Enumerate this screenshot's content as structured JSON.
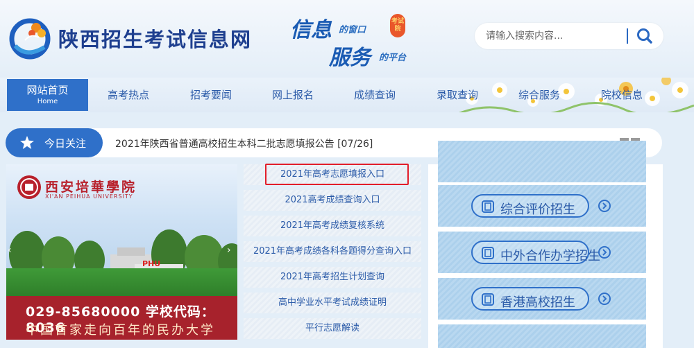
{
  "site": {
    "title": "陕西招生考试信息网",
    "slogan_line1": "信息",
    "slogan_sub1": "的窗口",
    "slogan_line2": "服务",
    "slogan_sub2": "的平台",
    "slogan_seal": "考试院"
  },
  "search": {
    "placeholder": "请输入搜索内容..."
  },
  "nav": {
    "home_label": "网站首页",
    "home_label_en": "Home",
    "items": [
      {
        "label": "高考热点"
      },
      {
        "label": "招考要闻"
      },
      {
        "label": "网上报名"
      },
      {
        "label": "成绩查询"
      },
      {
        "label": "录取查询"
      },
      {
        "label": "综合服务"
      },
      {
        "label": "院校信息"
      }
    ]
  },
  "focus": {
    "label": "今日关注",
    "notice": "2021年陕西省普通高校招生本科二批志愿填报公告 [07/26]"
  },
  "banner": {
    "school_name": "西安培華學院",
    "school_name_en": "XI'AN PEIHUA UNIVERSITY",
    "sign_text": "PHU",
    "phone_line": "029-85680000  学校代码：8036",
    "slogan": "中国首家走向百年的民办大学"
  },
  "links": [
    {
      "label": "2021年高考志愿填报入口"
    },
    {
      "label": "2021高考成绩查询入口"
    },
    {
      "label": "2021年高考成绩复核系统"
    },
    {
      "label": "2021年高考成绩各科各题得分查询入口"
    },
    {
      "label": "2021年高考招生计划查询"
    },
    {
      "label": "高中学业水平考试成绩证明"
    },
    {
      "label": "平行志愿解读"
    }
  ],
  "services": [
    {
      "label": "综合评价招生"
    },
    {
      "label": "中外合作办学招生"
    },
    {
      "label": "香港高校招生"
    }
  ],
  "colors": {
    "primary": "#2f70c9",
    "highlight_border": "#e21d2a",
    "banner_red": "#a7222c"
  }
}
